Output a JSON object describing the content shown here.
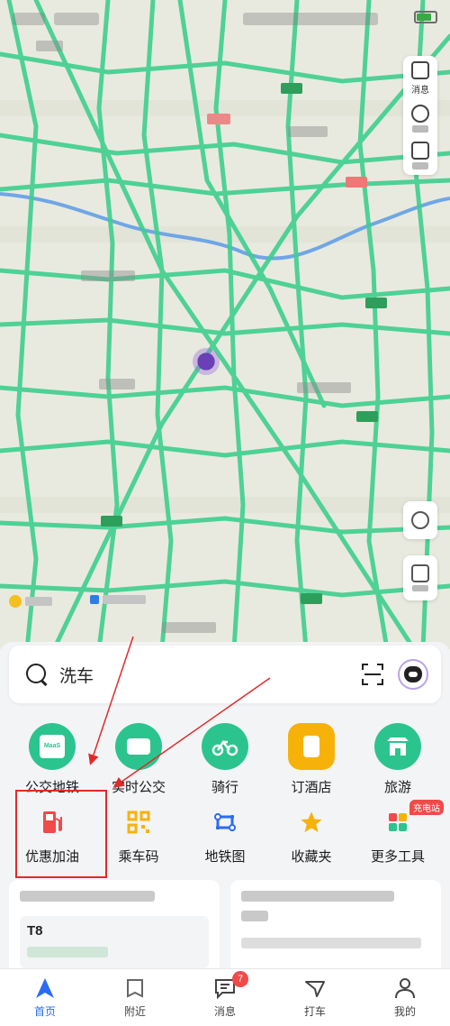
{
  "search": {
    "text": "洗车"
  },
  "shortcuts_row1": [
    {
      "label": "公交地铁",
      "icon": "bus-icon",
      "color": "#2bc48f",
      "inner": "MaaS"
    },
    {
      "label": "实时公交",
      "icon": "realtime-bus-icon",
      "color": "#2bc48f"
    },
    {
      "label": "骑行",
      "icon": "bicycle-icon",
      "color": "#2bc48f"
    },
    {
      "label": "订酒店",
      "icon": "hotel-icon",
      "color": "#f7b20a"
    },
    {
      "label": "旅游",
      "icon": "travel-icon",
      "color": "#2bc48f"
    }
  ],
  "shortcuts_row2": [
    {
      "label": "优惠加油",
      "icon": "fuel-pump-icon",
      "color": "#f04a4a"
    },
    {
      "label": "乘车码",
      "icon": "qr-code-icon",
      "color": "#f7b20a"
    },
    {
      "label": "地铁图",
      "icon": "subway-map-icon",
      "color": "#2c6cf2"
    },
    {
      "label": "收藏夹",
      "icon": "star-icon",
      "color": "#f7b20a"
    },
    {
      "label": "更多工具",
      "icon": "more-tools-icon",
      "color": "#2bc48f",
      "badge": "充电站"
    }
  ],
  "right_tools": {
    "messages": "消息"
  },
  "card_left": {
    "code": "T8"
  },
  "tabs": [
    {
      "label": "首页",
      "icon": "home-navigation-icon",
      "active": true
    },
    {
      "label": "附近",
      "icon": "nearby-icon"
    },
    {
      "label": "消息",
      "icon": "message-icon",
      "badge": "7"
    },
    {
      "label": "打车",
      "icon": "taxi-icon"
    },
    {
      "label": "我的",
      "icon": "profile-icon"
    }
  ],
  "colors": {
    "accent": "#2c6cf2",
    "road": "#3ecf8e",
    "river": "#6fa6e6",
    "annotation": "#e02a2a"
  }
}
